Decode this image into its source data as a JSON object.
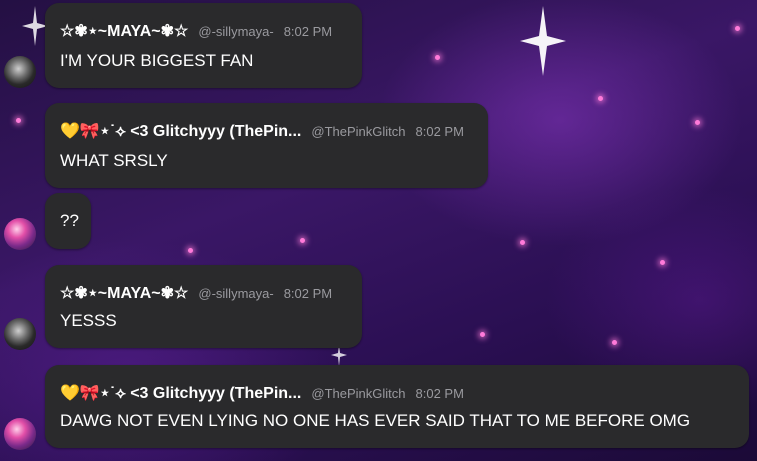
{
  "messages": [
    {
      "name": "☆✾⋆~MAYA~✾☆",
      "handle": "@-sillymaya-",
      "time": "8:02 PM",
      "text": "I'M YOUR BIGGEST FAN"
    },
    {
      "name": "💛🎀⋆˙⟡ <3 Glitchyyy (ThePin...",
      "handle": "@ThePinkGlitch",
      "time": "8:02 PM",
      "text": "WHAT SRSLY"
    },
    {
      "text": "??"
    },
    {
      "name": "☆✾⋆~MAYA~✾☆",
      "handle": "@-sillymaya-",
      "time": "8:02 PM",
      "text": "YESSS"
    },
    {
      "name": "💛🎀⋆˙⟡ <3 Glitchyyy (ThePin...",
      "handle": "@ThePinkGlitch",
      "time": "8:02 PM",
      "text": "DAWG NOT EVEN LYING NO ONE HAS EVER SAID THAT TO ME BEFORE OMG"
    }
  ],
  "avatars": {
    "maya": "maya-avatar",
    "glitch": "glitch-avatar"
  },
  "colors": {
    "bubble": "#2a2a2c",
    "accent_dot": "#ff7ad9"
  }
}
